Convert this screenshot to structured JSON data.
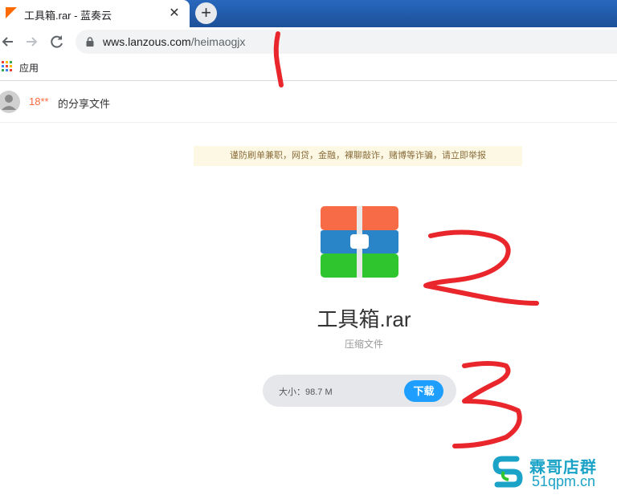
{
  "tab": {
    "title": "工具箱.rar - 蓝奏云",
    "close_glyph": "✕"
  },
  "new_tab_glyph": "+",
  "url": {
    "host": "wws.lanzous.com",
    "path": "/heimaogjx"
  },
  "bookmarks": {
    "apps_label": "应用"
  },
  "share": {
    "user": "18**",
    "label": "的分享文件"
  },
  "warning": "谨防刷单兼职，网贷，金融，裸聊敲诈，赌博等诈骗，请立即举报",
  "file": {
    "name": "工具箱.rar",
    "type": "压缩文件",
    "size_label": "大小：98.7 M",
    "download_label": "下载"
  },
  "watermark": {
    "name": "霖哥店群",
    "site": "51qpm.cn"
  },
  "colors": {
    "accent_blue": "#1e9fff",
    "user_orange": "#ff6a3d",
    "annotation_red": "#e8262c",
    "watermark": "#1aa3c7"
  },
  "annotations": [
    "1",
    "2",
    "3"
  ]
}
